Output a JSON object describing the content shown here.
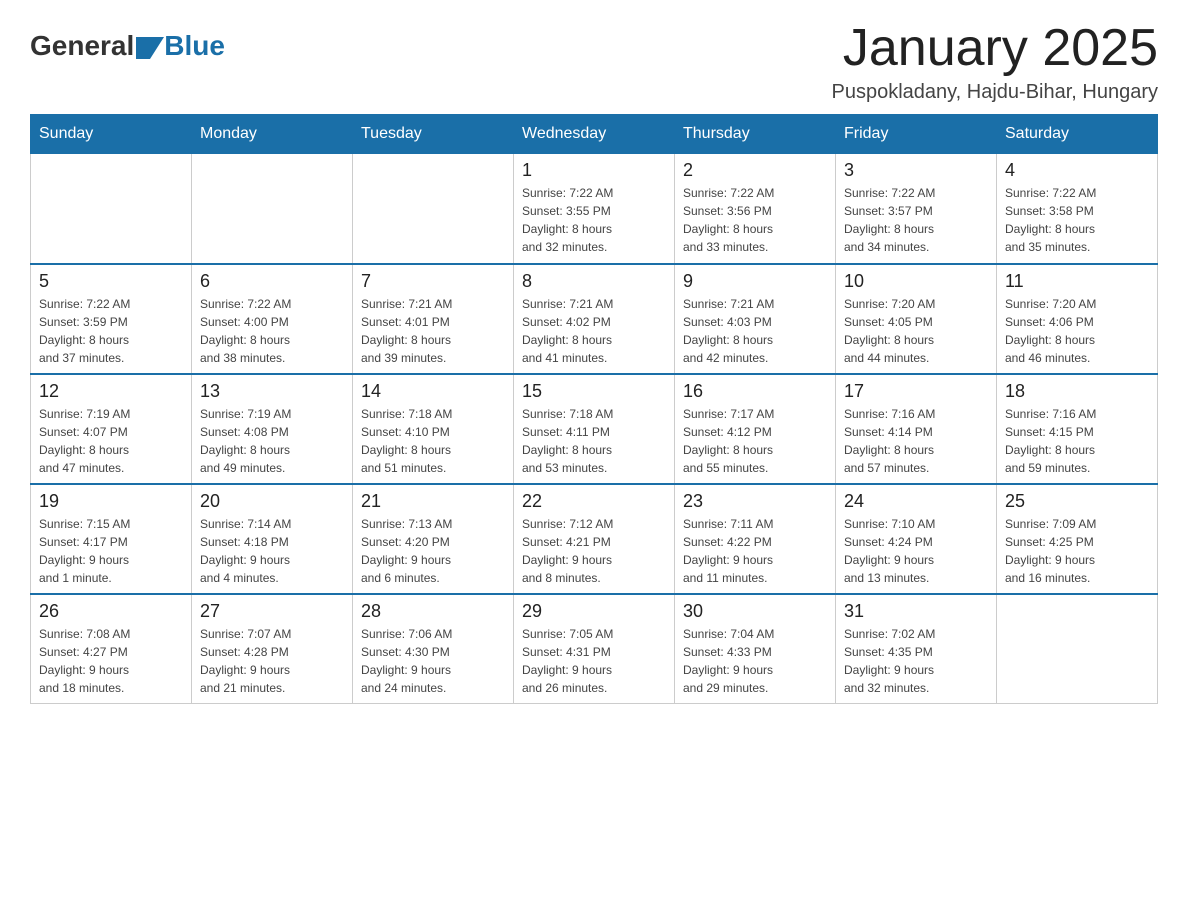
{
  "header": {
    "logo_general": "General",
    "logo_blue": "Blue",
    "month_title": "January 2025",
    "subtitle": "Puspokladany, Hajdu-Bihar, Hungary"
  },
  "weekdays": [
    "Sunday",
    "Monday",
    "Tuesday",
    "Wednesday",
    "Thursday",
    "Friday",
    "Saturday"
  ],
  "weeks": [
    [
      {
        "day": "",
        "info": ""
      },
      {
        "day": "",
        "info": ""
      },
      {
        "day": "",
        "info": ""
      },
      {
        "day": "1",
        "info": "Sunrise: 7:22 AM\nSunset: 3:55 PM\nDaylight: 8 hours\nand 32 minutes."
      },
      {
        "day": "2",
        "info": "Sunrise: 7:22 AM\nSunset: 3:56 PM\nDaylight: 8 hours\nand 33 minutes."
      },
      {
        "day": "3",
        "info": "Sunrise: 7:22 AM\nSunset: 3:57 PM\nDaylight: 8 hours\nand 34 minutes."
      },
      {
        "day": "4",
        "info": "Sunrise: 7:22 AM\nSunset: 3:58 PM\nDaylight: 8 hours\nand 35 minutes."
      }
    ],
    [
      {
        "day": "5",
        "info": "Sunrise: 7:22 AM\nSunset: 3:59 PM\nDaylight: 8 hours\nand 37 minutes."
      },
      {
        "day": "6",
        "info": "Sunrise: 7:22 AM\nSunset: 4:00 PM\nDaylight: 8 hours\nand 38 minutes."
      },
      {
        "day": "7",
        "info": "Sunrise: 7:21 AM\nSunset: 4:01 PM\nDaylight: 8 hours\nand 39 minutes."
      },
      {
        "day": "8",
        "info": "Sunrise: 7:21 AM\nSunset: 4:02 PM\nDaylight: 8 hours\nand 41 minutes."
      },
      {
        "day": "9",
        "info": "Sunrise: 7:21 AM\nSunset: 4:03 PM\nDaylight: 8 hours\nand 42 minutes."
      },
      {
        "day": "10",
        "info": "Sunrise: 7:20 AM\nSunset: 4:05 PM\nDaylight: 8 hours\nand 44 minutes."
      },
      {
        "day": "11",
        "info": "Sunrise: 7:20 AM\nSunset: 4:06 PM\nDaylight: 8 hours\nand 46 minutes."
      }
    ],
    [
      {
        "day": "12",
        "info": "Sunrise: 7:19 AM\nSunset: 4:07 PM\nDaylight: 8 hours\nand 47 minutes."
      },
      {
        "day": "13",
        "info": "Sunrise: 7:19 AM\nSunset: 4:08 PM\nDaylight: 8 hours\nand 49 minutes."
      },
      {
        "day": "14",
        "info": "Sunrise: 7:18 AM\nSunset: 4:10 PM\nDaylight: 8 hours\nand 51 minutes."
      },
      {
        "day": "15",
        "info": "Sunrise: 7:18 AM\nSunset: 4:11 PM\nDaylight: 8 hours\nand 53 minutes."
      },
      {
        "day": "16",
        "info": "Sunrise: 7:17 AM\nSunset: 4:12 PM\nDaylight: 8 hours\nand 55 minutes."
      },
      {
        "day": "17",
        "info": "Sunrise: 7:16 AM\nSunset: 4:14 PM\nDaylight: 8 hours\nand 57 minutes."
      },
      {
        "day": "18",
        "info": "Sunrise: 7:16 AM\nSunset: 4:15 PM\nDaylight: 8 hours\nand 59 minutes."
      }
    ],
    [
      {
        "day": "19",
        "info": "Sunrise: 7:15 AM\nSunset: 4:17 PM\nDaylight: 9 hours\nand 1 minute."
      },
      {
        "day": "20",
        "info": "Sunrise: 7:14 AM\nSunset: 4:18 PM\nDaylight: 9 hours\nand 4 minutes."
      },
      {
        "day": "21",
        "info": "Sunrise: 7:13 AM\nSunset: 4:20 PM\nDaylight: 9 hours\nand 6 minutes."
      },
      {
        "day": "22",
        "info": "Sunrise: 7:12 AM\nSunset: 4:21 PM\nDaylight: 9 hours\nand 8 minutes."
      },
      {
        "day": "23",
        "info": "Sunrise: 7:11 AM\nSunset: 4:22 PM\nDaylight: 9 hours\nand 11 minutes."
      },
      {
        "day": "24",
        "info": "Sunrise: 7:10 AM\nSunset: 4:24 PM\nDaylight: 9 hours\nand 13 minutes."
      },
      {
        "day": "25",
        "info": "Sunrise: 7:09 AM\nSunset: 4:25 PM\nDaylight: 9 hours\nand 16 minutes."
      }
    ],
    [
      {
        "day": "26",
        "info": "Sunrise: 7:08 AM\nSunset: 4:27 PM\nDaylight: 9 hours\nand 18 minutes."
      },
      {
        "day": "27",
        "info": "Sunrise: 7:07 AM\nSunset: 4:28 PM\nDaylight: 9 hours\nand 21 minutes."
      },
      {
        "day": "28",
        "info": "Sunrise: 7:06 AM\nSunset: 4:30 PM\nDaylight: 9 hours\nand 24 minutes."
      },
      {
        "day": "29",
        "info": "Sunrise: 7:05 AM\nSunset: 4:31 PM\nDaylight: 9 hours\nand 26 minutes."
      },
      {
        "day": "30",
        "info": "Sunrise: 7:04 AM\nSunset: 4:33 PM\nDaylight: 9 hours\nand 29 minutes."
      },
      {
        "day": "31",
        "info": "Sunrise: 7:02 AM\nSunset: 4:35 PM\nDaylight: 9 hours\nand 32 minutes."
      },
      {
        "day": "",
        "info": ""
      }
    ]
  ]
}
